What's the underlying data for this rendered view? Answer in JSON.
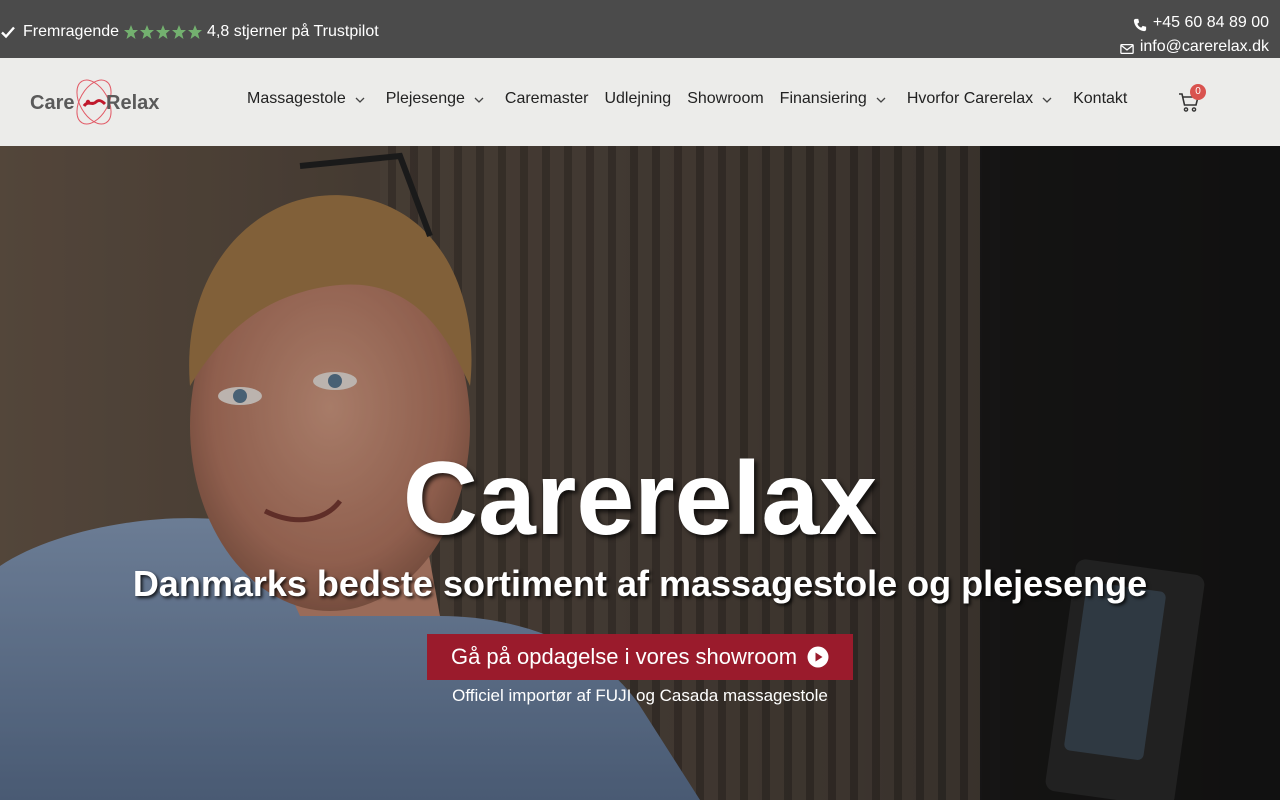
{
  "topbar": {
    "rating_label": "Fremragende",
    "rating_text": "4,8 stjerner på Trustpilot",
    "star_color": "#73b06f",
    "phone": "+45 60 84 89 00",
    "email": "info@carerelax.dk"
  },
  "header": {
    "logo_text_left": "Care",
    "logo_text_right": "Relax",
    "nav": [
      {
        "label": "Massagestole",
        "has_dropdown": true
      },
      {
        "label": "Plejesenge",
        "has_dropdown": true
      },
      {
        "label": "Caremaster",
        "has_dropdown": false
      },
      {
        "label": "Udlejning",
        "has_dropdown": false
      },
      {
        "label": "Showroom",
        "has_dropdown": false
      },
      {
        "label": "Finansiering",
        "has_dropdown": true
      },
      {
        "label": "Hvorfor Carerelax",
        "has_dropdown": true
      },
      {
        "label": "Kontakt",
        "has_dropdown": false
      }
    ],
    "cart_count": "0"
  },
  "hero": {
    "title": "Carerelax",
    "subtitle": "Danmarks bedste sortiment af massagestole og plejesenge",
    "button_label": "Gå på opdagelse i vores showroom",
    "note": "Officiel importør af FUJI og Casada massagestole"
  },
  "colors": {
    "topbar_bg": "#4b4b4b",
    "header_bg": "#ececea",
    "brand_red": "#9a1b2c",
    "badge_red": "#d9534f"
  }
}
